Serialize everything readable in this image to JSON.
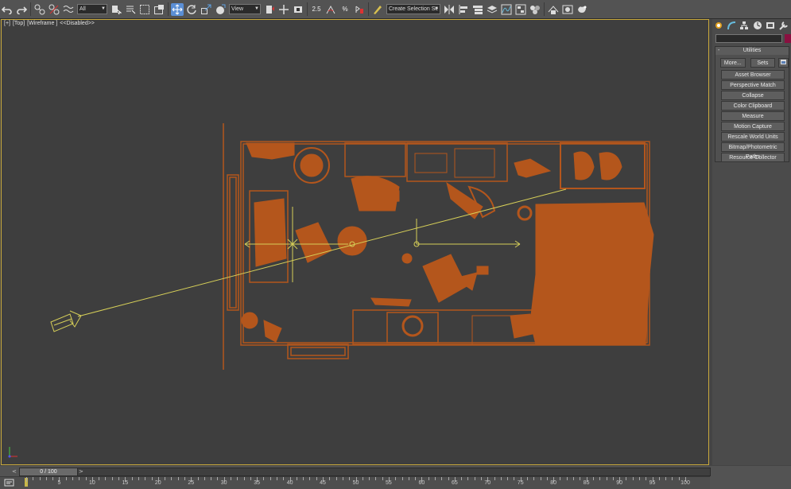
{
  "toolbar": {
    "selection_filter": "All",
    "reference_coord": "View",
    "snap_value": "2.5",
    "angle_snap": "",
    "named_selection_placeholder": "Create Selection Se"
  },
  "viewport": {
    "label_plus": "[+]",
    "label_view": "[Top]",
    "label_shading": "[Wireframe ]",
    "label_disabled": "<<Disabled>>",
    "border_color": "#c9a93c",
    "object_color": "#b4561c",
    "helper_color": "#d6cf58"
  },
  "command_panel": {
    "tabs": [
      "create-icon",
      "modify-icon",
      "hierarchy-icon",
      "motion-icon",
      "display-icon",
      "utilities-icon"
    ],
    "rollout_title": "Utilities",
    "more_label": "More...",
    "sets_label": "Sets",
    "utilities": [
      "Asset Browser",
      "Perspective Match",
      "Collapse",
      "Color Clipboard",
      "Measure",
      "Motion Capture",
      "Rescale World Units",
      "Bitmap/Photometric Paths",
      "Resource Collector"
    ],
    "swatch_color": "#8a1040"
  },
  "timeline": {
    "frame_readout": "0 / 100",
    "tick_labels": [
      "0",
      "5",
      "10",
      "15",
      "20",
      "25",
      "30",
      "35",
      "40",
      "45",
      "50",
      "55",
      "60",
      "65",
      "70",
      "75",
      "80",
      "85",
      "90",
      "95",
      "100"
    ]
  }
}
